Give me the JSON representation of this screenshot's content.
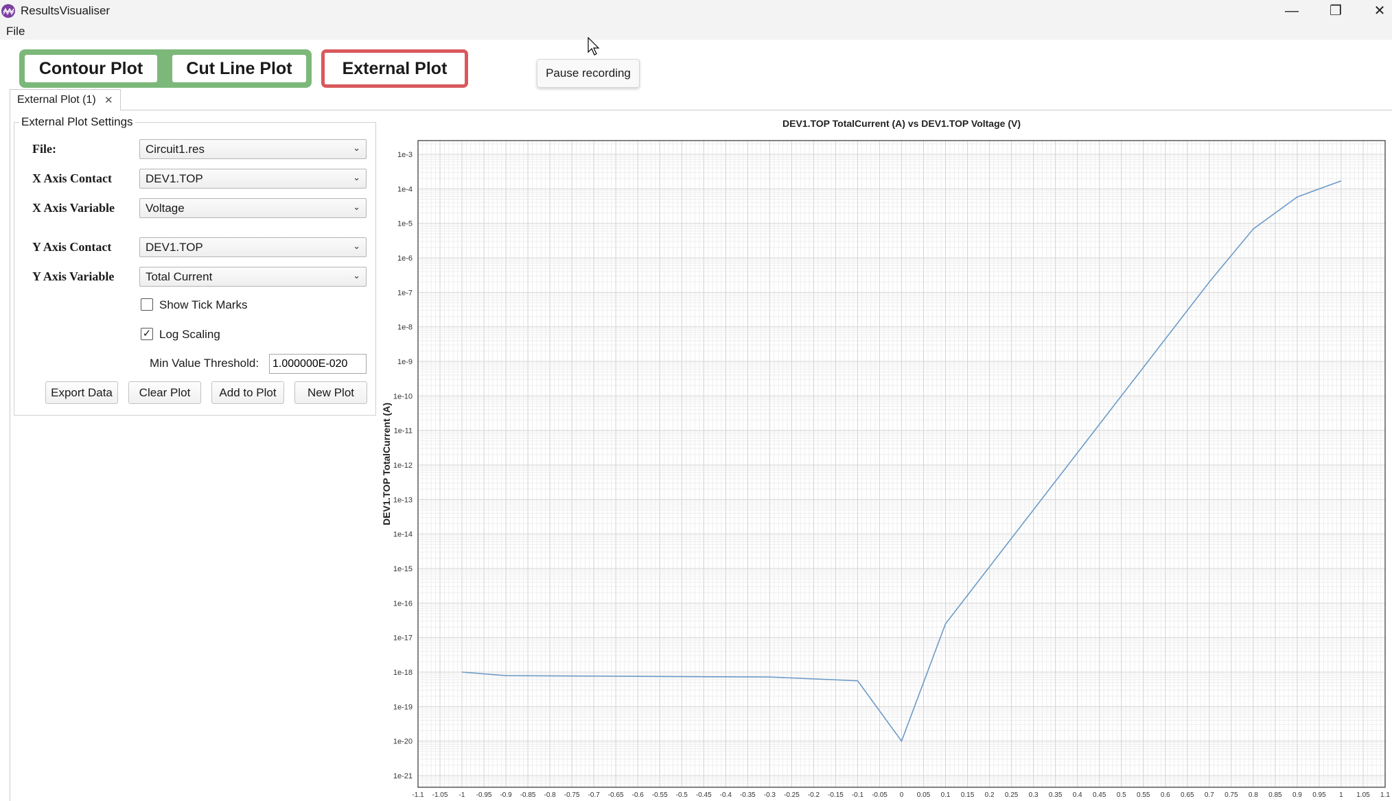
{
  "window": {
    "title": "ResultsVisualiser",
    "controls": {
      "minimize": "—",
      "maximize": "❐",
      "close": "✕"
    }
  },
  "menu": {
    "file": "File"
  },
  "plot_buttons": {
    "contour": "Contour Plot",
    "cutline": "Cut Line Plot",
    "external": "External Plot"
  },
  "colors": {
    "green_accent": "#7cb87a",
    "red_accent": "#d9595c",
    "series_line": "#6b9ac8",
    "app_icon": "#7b3fa0"
  },
  "tooltip": "Pause recording",
  "tab": {
    "label": "External Plot (1)",
    "close": "✕"
  },
  "settings": {
    "group_title": "External Plot Settings",
    "file_label": "File:",
    "file_value": "Circuit1.res",
    "x_contact_label": "X Axis Contact",
    "x_contact_value": "DEV1.TOP",
    "x_variable_label": "X Axis Variable",
    "x_variable_value": "Voltage",
    "y_contact_label": "Y Axis Contact",
    "y_contact_value": "DEV1.TOP",
    "y_variable_label": "Y Axis Variable",
    "y_variable_value": "Total Current",
    "show_tick_marks_label": "Show Tick Marks",
    "show_tick_marks_checked": false,
    "log_scaling_label": "Log Scaling",
    "log_scaling_checked": true,
    "checkmark": "✓",
    "min_threshold_label": "Min Value Threshold:",
    "min_threshold_value": "1.000000E-020",
    "dropdown_arrow": "⌄",
    "buttons": {
      "export": "Export Data",
      "clear": "Clear Plot",
      "add": "Add to Plot",
      "new": "New Plot"
    }
  },
  "chart_data": {
    "type": "line",
    "title": "DEV1.TOP TotalCurrent (A) vs DEV1.TOP Voltage (V)",
    "xlabel": "",
    "ylabel": "DEV1.TOP TotalCurrent (A)",
    "xlim": [
      -1.1,
      1.1
    ],
    "y_log_exp_range": [
      -21,
      -3
    ],
    "y_scale": "log",
    "grid": true,
    "x_tick_labels": [
      "-1.1",
      "-1.05",
      "-1",
      "-0.95",
      "-0.9",
      "-0.85",
      "-0.8",
      "-0.75",
      "-0.7",
      "-0.65",
      "-0.6",
      "-0.55",
      "-0.5",
      "-0.45",
      "-0.4",
      "-0.35",
      "-0.3",
      "-0.25",
      "-0.2",
      "-0.15",
      "-0.1",
      "-0.05",
      "0",
      "0.05",
      "0.1",
      "0.15",
      "0.2",
      "0.25",
      "0.3",
      "0.35",
      "0.4",
      "0.45",
      "0.5",
      "0.55",
      "0.6",
      "0.65",
      "0.7",
      "0.75",
      "0.8",
      "0.85",
      "0.9",
      "0.95",
      "1",
      "1.05",
      "1.1"
    ],
    "y_tick_labels": [
      "1e-21",
      "1e-20",
      "1e-19",
      "1e-18",
      "1e-17",
      "1e-16",
      "1e-15",
      "1e-14",
      "1e-13",
      "1e-12",
      "1e-11",
      "1e-10",
      "1e-9",
      "1e-8",
      "1e-7",
      "1e-6",
      "1e-5",
      "1e-4",
      "1e-3"
    ],
    "series": [
      {
        "x": [
          -1.0,
          -0.9,
          -0.3,
          -0.1,
          0.0,
          0.1,
          0.7,
          0.8,
          0.9,
          1.0
        ],
        "y": [
          1e-18,
          7.9e-19,
          7.2e-19,
          5.6e-19,
          1e-20,
          2.5e-17,
          2e-07,
          6.9e-06,
          5.8e-05,
          0.00017
        ]
      }
    ]
  }
}
